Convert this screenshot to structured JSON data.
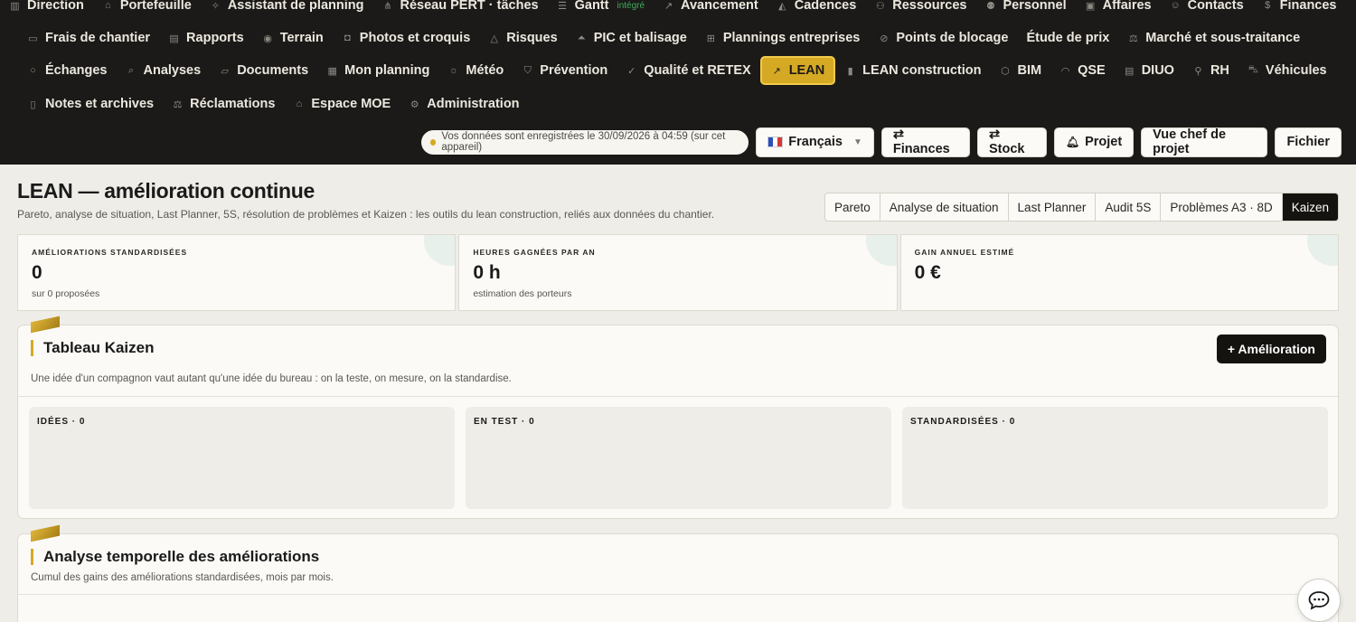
{
  "nav": {
    "row1": [
      {
        "label": "Direction",
        "icon": "chart-icon"
      },
      {
        "label": "Portefeuille",
        "icon": "home-icon"
      },
      {
        "label": "Assistant de planning",
        "icon": "sparkle-icon"
      },
      {
        "label": "Réseau PERT · tâches",
        "icon": "network-icon"
      },
      {
        "label": "Gantt",
        "icon": "gantt-icon",
        "badge": "intégré"
      },
      {
        "label": "Avancement",
        "icon": "trend-icon"
      },
      {
        "label": "Cadences",
        "icon": "area-chart-icon"
      },
      {
        "label": "Ressources",
        "icon": "user-plus-icon"
      },
      {
        "label": "Personnel",
        "icon": "users-icon"
      },
      {
        "label": "Affaires",
        "icon": "briefcase-icon"
      },
      {
        "label": "Contacts",
        "icon": "contact-icon"
      },
      {
        "label": "Finances",
        "icon": "dollar-icon"
      }
    ],
    "row2": [
      {
        "label": "Frais de chantier",
        "icon": "wallet-icon"
      },
      {
        "label": "Rapports",
        "icon": "report-icon"
      },
      {
        "label": "Terrain",
        "icon": "pin-icon"
      },
      {
        "label": "Photos et croquis",
        "icon": "camera-icon"
      },
      {
        "label": "Risques",
        "icon": "warning-icon"
      },
      {
        "label": "PIC et balisage",
        "icon": "cone-icon"
      },
      {
        "label": "Plannings entreprises",
        "icon": "grid-icon"
      },
      {
        "label": "Points de blocage",
        "icon": "block-icon"
      },
      {
        "label": "Étude de prix",
        "icon": ""
      },
      {
        "label": "Marché et sous-traitance",
        "icon": "scale-icon"
      }
    ],
    "row3": [
      {
        "label": "Échanges",
        "icon": "chat-icon"
      },
      {
        "label": "Analyses",
        "icon": "search-icon"
      },
      {
        "label": "Documents",
        "icon": "folder-icon"
      },
      {
        "label": "Mon planning",
        "icon": "calendar-icon"
      },
      {
        "label": "Météo",
        "icon": "weather-icon"
      },
      {
        "label": "Prévention",
        "icon": "shield-icon"
      },
      {
        "label": "Qualité et RETEX",
        "icon": "check-icon"
      },
      {
        "label": "LEAN",
        "icon": "trend-icon",
        "active": true
      },
      {
        "label": "LEAN construction",
        "icon": "bar-chart-icon"
      },
      {
        "label": "BIM",
        "icon": "cube-icon"
      },
      {
        "label": "QSE",
        "icon": "helmet-icon"
      },
      {
        "label": "DIUO",
        "icon": "doc-icon"
      },
      {
        "label": "RH",
        "icon": "user-icon"
      },
      {
        "label": "Véhicules",
        "icon": "car-icon"
      }
    ],
    "row4": [
      {
        "label": "Notes et archives",
        "icon": "note-icon"
      },
      {
        "label": "Réclamations",
        "icon": "scale-icon"
      },
      {
        "label": "Espace MOE",
        "icon": "building-icon"
      },
      {
        "label": "Administration",
        "icon": "gear-icon"
      }
    ]
  },
  "actionbar": {
    "save_status": "Vos données sont enregistrées le 30/09/2026 à 04:59 (sur cet appareil)",
    "language": "Français",
    "finances_btn": "⇄ Finances",
    "stock_btn": "⇄ Stock",
    "projet_btn": "Projet",
    "chef_btn": "Vue chef de projet",
    "fichier_btn": "Fichier"
  },
  "page": {
    "title": "LEAN — amélioration continue",
    "subtitle": "Pareto, analyse de situation, Last Planner, 5S, résolution de problèmes et Kaizen : les outils du lean construction, reliés aux données du chantier.",
    "tabs": [
      "Pareto",
      "Analyse de situation",
      "Last Planner",
      "Audit 5S",
      "Problèmes A3 · 8D",
      "Kaizen"
    ],
    "active_tab": "Kaizen"
  },
  "stats": [
    {
      "label": "Améliorations standardisées",
      "value": "0",
      "note": "sur 0 proposées"
    },
    {
      "label": "Heures gagnées par an",
      "value": "0 h",
      "note": "estimation des porteurs"
    },
    {
      "label": "Gain annuel estimé",
      "value": "0 €",
      "note": ""
    }
  ],
  "kaizen": {
    "title": "Tableau Kaizen",
    "subtitle": "Une idée d'un compagnon vaut autant qu'une idée du bureau : on la teste, on mesure, on la standardise.",
    "add_btn": "+ Amélioration",
    "columns": [
      "Idées · 0",
      "En test · 0",
      "Standardisées · 0"
    ]
  },
  "analyse": {
    "title": "Analyse temporelle des améliorations",
    "subtitle": "Cumul des gains des améliorations standardisées, mois par mois."
  },
  "colors": {
    "accent": "#d6a924",
    "dark": "#1b1a18",
    "background": "#efede8"
  }
}
